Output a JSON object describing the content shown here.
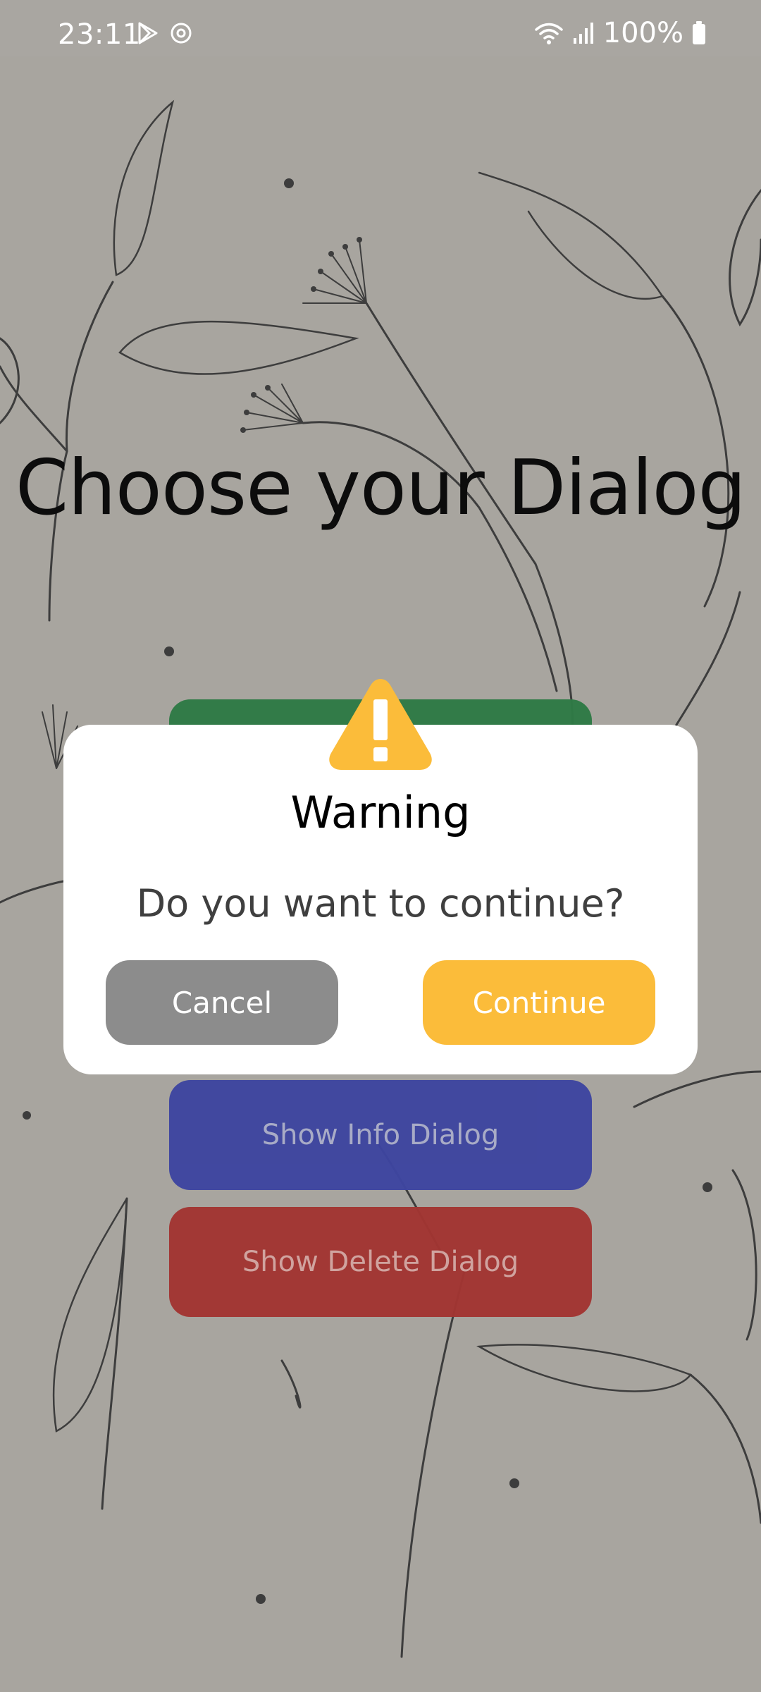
{
  "status_bar": {
    "time": "23:11",
    "battery": "100%",
    "icons": [
      "play-store-icon",
      "sync-icon",
      "wifi-icon",
      "signal-icon",
      "battery-icon"
    ]
  },
  "main": {
    "title": "Choose your Dialog",
    "buttons": {
      "info": "Show Info Dialog",
      "delete": "Show Delete Dialog"
    }
  },
  "dialog": {
    "icon": "warning-icon",
    "title": "Warning",
    "message": "Do you want to continue?",
    "cancel_label": "Cancel",
    "continue_label": "Continue"
  },
  "colors": {
    "background": "#a8a59f",
    "success": "#2e7a45",
    "info": "#3e45a0",
    "delete": "#a23532",
    "warning": "#fbbc3a",
    "cancel": "#8c8c8c"
  }
}
